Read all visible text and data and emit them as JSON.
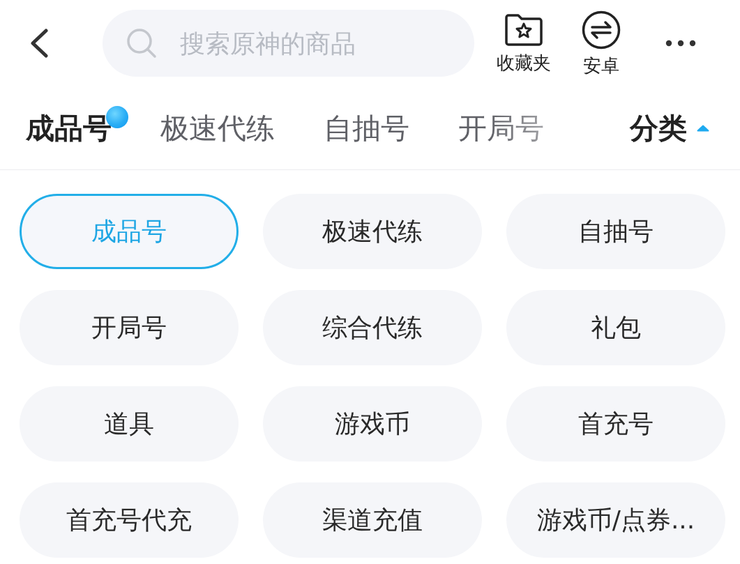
{
  "header": {
    "search": {
      "placeholder": "搜索原神的商品"
    },
    "actions": [
      {
        "kind": "favorites",
        "label": "收藏夹"
      },
      {
        "kind": "android",
        "label": "安卓"
      }
    ]
  },
  "tabs": [
    {
      "label": "成品号",
      "selected": true,
      "badge": true
    },
    {
      "label": "极速代练",
      "selected": false,
      "badge": false
    },
    {
      "label": "自抽号",
      "selected": false,
      "badge": false
    },
    {
      "label": "开局号",
      "selected": false,
      "badge": false
    }
  ],
  "category_toggle": {
    "label": "分类",
    "expanded": true
  },
  "categories": [
    {
      "label": "成品号",
      "selected": true
    },
    {
      "label": "极速代练",
      "selected": false
    },
    {
      "label": "自抽号",
      "selected": false
    },
    {
      "label": "开局号",
      "selected": false
    },
    {
      "label": "综合代练",
      "selected": false
    },
    {
      "label": "礼包",
      "selected": false
    },
    {
      "label": "道具",
      "selected": false
    },
    {
      "label": "游戏币",
      "selected": false
    },
    {
      "label": "首充号",
      "selected": false
    },
    {
      "label": "首充号代充",
      "selected": false
    },
    {
      "label": "渠道充值",
      "selected": false
    },
    {
      "label": "游戏币/点券...",
      "selected": false
    }
  ]
}
